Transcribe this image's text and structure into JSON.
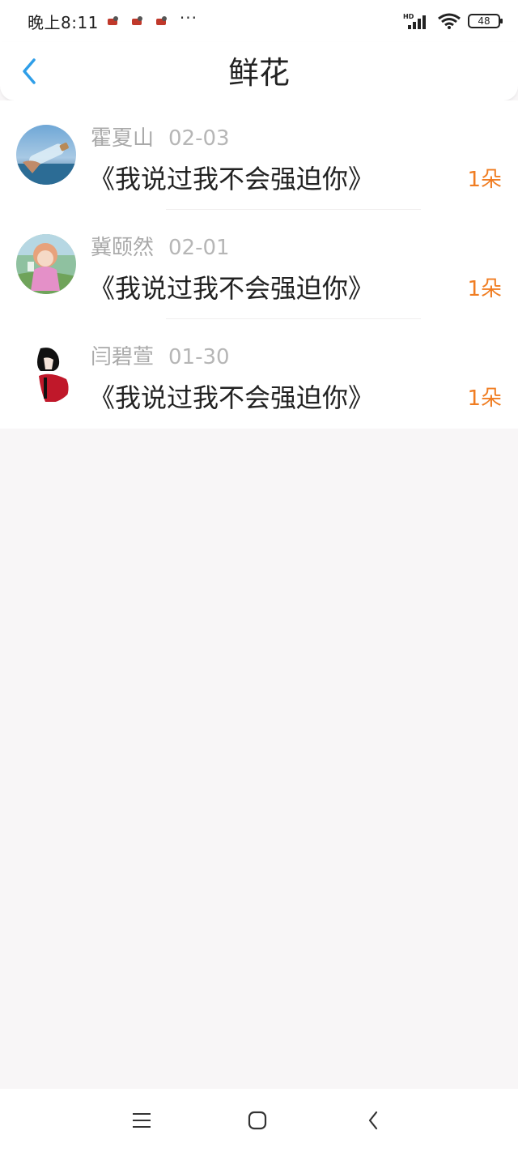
{
  "status_bar": {
    "time": "晚上8:11",
    "dots": "···",
    "network": "HD",
    "battery": "48"
  },
  "header": {
    "title": "鲜花"
  },
  "items": [
    {
      "name": "霍夏山",
      "date": "02-03",
      "message": "《我说过我不会强迫你》",
      "count": "1朵"
    },
    {
      "name": "冀颐然",
      "date": "02-01",
      "message": "《我说过我不会强迫你》",
      "count": "1朵"
    },
    {
      "name": "闫碧萱",
      "date": "01-30",
      "message": "《我说过我不会强迫你》",
      "count": "1朵"
    }
  ],
  "colors": {
    "accent": "#2f9ee8",
    "flower_count": "#f07d22",
    "background": "#f8f6f7"
  },
  "icons": {
    "back": "chevron-left-icon",
    "nav_menu": "menu-icon",
    "nav_home": "home-square-icon",
    "nav_back": "back-icon"
  }
}
